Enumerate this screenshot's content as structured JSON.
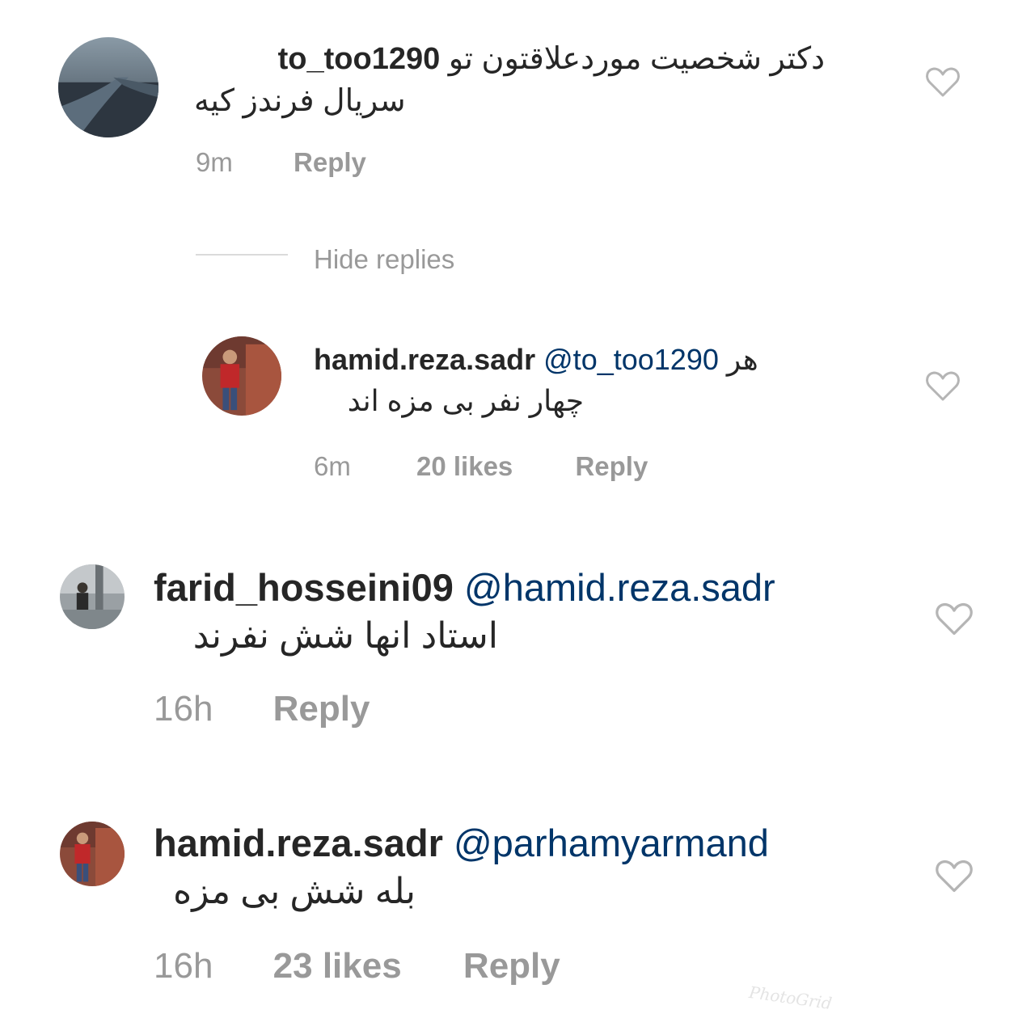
{
  "comments": [
    {
      "username": "to_too1290",
      "mention": "",
      "text_line1": "دکتر شخصیت موردعلاقتون تو",
      "text_line2": "سریال فرندز کیه",
      "time": "9m",
      "likes": "",
      "reply_label": "Reply"
    },
    {
      "username": "hamid.reza.sadr",
      "mention": "@to_too1290",
      "text_line1": "هر",
      "text_line2": "چهار نفر بی مزه اند",
      "time": "6m",
      "likes": "20 likes",
      "reply_label": "Reply"
    },
    {
      "username": "farid_hosseini09",
      "mention": "@hamid.reza.sadr",
      "text_line1": "",
      "text_line2": "استاد انها شش نفرند",
      "time": "16h",
      "likes": "",
      "reply_label": "Reply"
    },
    {
      "username": "hamid.reza.sadr",
      "mention": "@parhamyarmand",
      "text_line1": "",
      "text_line2": "بله شش بی مزه",
      "time": "16h",
      "likes": "23 likes",
      "reply_label": "Reply"
    }
  ],
  "hide_replies_label": "Hide replies",
  "watermark": "PhotoGrid",
  "icons": {
    "like": "heart-outline-icon"
  },
  "colors": {
    "username": "#262626",
    "mention": "#003569",
    "meta": "#999999",
    "divider": "#dbdbdb"
  }
}
